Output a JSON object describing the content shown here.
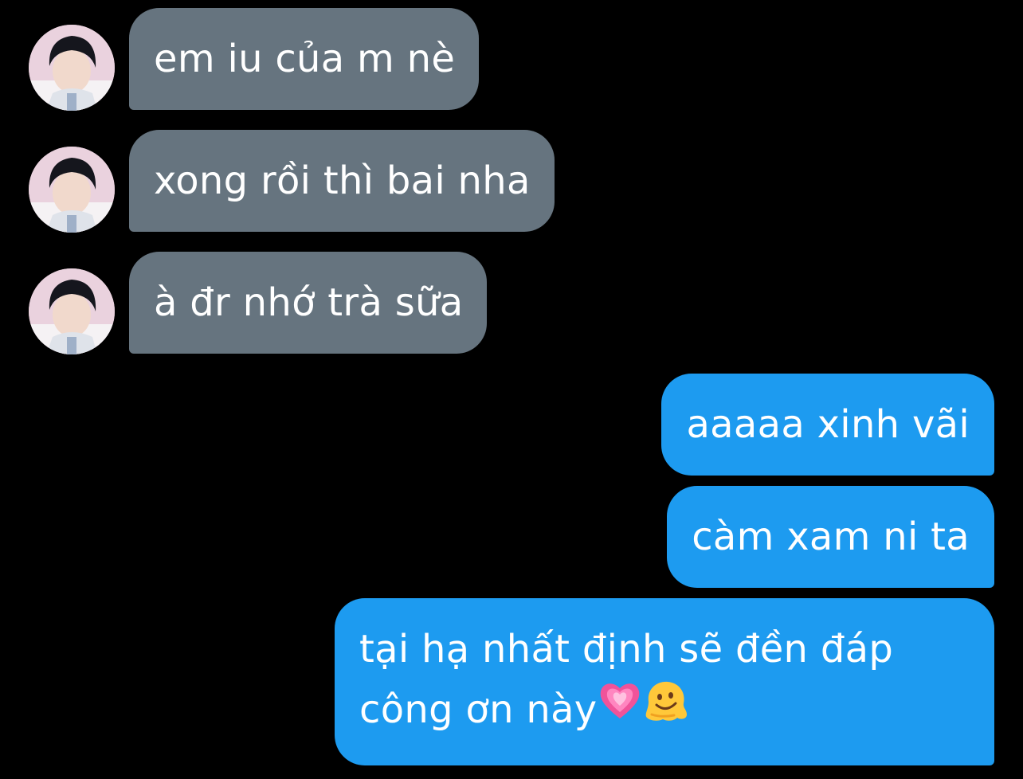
{
  "messages": [
    {
      "id": 1,
      "direction": "incoming",
      "text": "em iu của m nè",
      "avatar_icon": "profile-photo-icon"
    },
    {
      "id": 2,
      "direction": "incoming",
      "text": "xong rồi thì bai nha",
      "avatar_icon": "profile-photo-icon"
    },
    {
      "id": 3,
      "direction": "incoming",
      "text": "à đr nhớ trà sữa",
      "avatar_icon": "profile-photo-icon"
    },
    {
      "id": 4,
      "direction": "outgoing",
      "text": "aaaaa xinh vãi"
    },
    {
      "id": 5,
      "direction": "outgoing",
      "text": "càm xam ni ta"
    },
    {
      "id": 6,
      "direction": "outgoing",
      "line1": "tại hạ nhất định sẽ đền đáp",
      "line2": "công ơn này",
      "emojis": [
        "growing-heart-emoji",
        "melting-face-emoji"
      ]
    }
  ],
  "colors": {
    "background": "#000000",
    "incoming_bubble": "#66747f",
    "outgoing_bubble": "#1d9bf0",
    "bubble_text": "#ffffff"
  }
}
